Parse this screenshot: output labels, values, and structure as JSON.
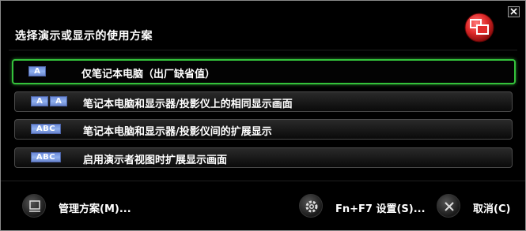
{
  "dialog": {
    "title": "选择演示或显示的使用方案",
    "close_icon": "close-icon",
    "brand_icon": "dual-display-icon"
  },
  "options": [
    {
      "icon_text": [
        "A"
      ],
      "label": "仅笔记本电脑（出厂缺省值）",
      "selected": true
    },
    {
      "icon_text": [
        "A",
        "A"
      ],
      "label": "笔记本电脑和显示器/投影仪上的相同显示画面",
      "selected": false
    },
    {
      "icon_text": [
        "ABC"
      ],
      "label": "笔记本电脑和显示器/投影仪间的扩展显示",
      "selected": false
    },
    {
      "icon_text": [
        "ABC"
      ],
      "label": "启用演示者视图时扩展显示画面",
      "selected": false
    }
  ],
  "footer": {
    "manage_label": "管理方案(M)...",
    "settings_label": "Fn+F7 设置(S)...",
    "cancel_label": "取消(C)"
  },
  "colors": {
    "selection_border": "#34c23b",
    "brand_red": "#e02a2a",
    "icon_blue": "#7f9fe6"
  }
}
